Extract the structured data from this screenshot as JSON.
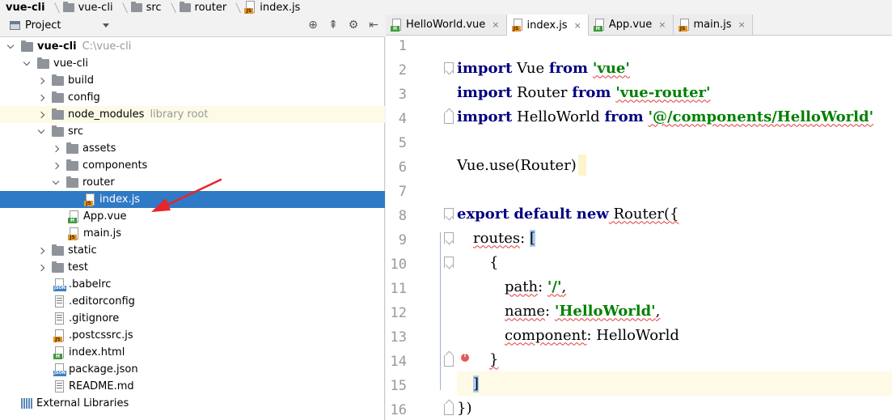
{
  "breadcrumb": [
    "vue-cli",
    "vue-cli",
    "src",
    "router",
    "index.js"
  ],
  "project_panel": {
    "title": "Project",
    "tree": [
      {
        "label": "vue-cli",
        "sub": "C:\\vue-cli",
        "type": "project",
        "state": "expanded"
      },
      {
        "label": "vue-cli",
        "type": "folder",
        "state": "expanded"
      },
      {
        "label": "build",
        "type": "folder",
        "state": "collapsed"
      },
      {
        "label": "config",
        "type": "folder",
        "state": "collapsed"
      },
      {
        "label": "node_modules",
        "sub": "library root",
        "type": "folder",
        "state": "collapsed"
      },
      {
        "label": "src",
        "type": "folder",
        "state": "expanded"
      },
      {
        "label": "assets",
        "type": "folder",
        "state": "collapsed"
      },
      {
        "label": "components",
        "type": "folder",
        "state": "collapsed"
      },
      {
        "label": "router",
        "type": "folder",
        "state": "expanded"
      },
      {
        "label": "index.js",
        "type": "js"
      },
      {
        "label": "App.vue",
        "type": "vue"
      },
      {
        "label": "main.js",
        "type": "js"
      },
      {
        "label": "static",
        "type": "folder",
        "state": "collapsed"
      },
      {
        "label": "test",
        "type": "folder",
        "state": "collapsed"
      },
      {
        "label": ".babelrc",
        "type": "json"
      },
      {
        "label": ".editorconfig",
        "type": "text"
      },
      {
        "label": ".gitignore",
        "type": "text"
      },
      {
        "label": ".postcssrc.js",
        "type": "js"
      },
      {
        "label": "index.html",
        "type": "html"
      },
      {
        "label": "package.json",
        "type": "json"
      },
      {
        "label": "README.md",
        "type": "text"
      },
      {
        "label": "External Libraries",
        "type": "libraries"
      }
    ],
    "selected": "index.js"
  },
  "tabs": [
    {
      "label": "HelloWorld.vue",
      "type": "vue",
      "active": false
    },
    {
      "label": "index.js",
      "type": "js",
      "active": true
    },
    {
      "label": "App.vue",
      "type": "vue",
      "active": false
    },
    {
      "label": "main.js",
      "type": "js",
      "active": false
    }
  ],
  "tab_close_glyph": "×",
  "icon_tags": {
    "js": "JS",
    "vue": "H",
    "html": "H",
    "json": "JSON"
  },
  "code_lines": [
    "1",
    "2",
    "3",
    "4",
    "5",
    "6",
    "7",
    "8",
    "9",
    "10",
    "11",
    "12",
    "13",
    "14",
    "15",
    "16"
  ],
  "code": {
    "l1": {
      "kw": "import",
      "name": " Vue ",
      "from": "from",
      "str": "'vue'"
    },
    "l2": {
      "kw": "import",
      "name": " Router ",
      "from": "from",
      "str": "'vue-router'"
    },
    "l3": {
      "kw": "import",
      "name": " HelloWorld ",
      "from": "from",
      "str": "'@/components/HelloWorld'"
    },
    "l5": {
      "text": "Vue.use(Router)"
    },
    "l7": {
      "kw1": "export",
      "kw2": "default",
      "kw3": "new",
      "rest": " Router({"
    },
    "l8": {
      "prop": "routes",
      "colon": ": ",
      "bracket": "["
    },
    "l9": {
      "text": "{"
    },
    "l10": {
      "prop": "path",
      "colon": ": ",
      "str": "'/'",
      "tail": ","
    },
    "l11": {
      "prop": "name",
      "colon": ": ",
      "str": "'HelloWorld'",
      "tail": ","
    },
    "l12": {
      "prop": "component",
      "colon": ": ",
      "value": "HelloWorld"
    },
    "l13": {
      "text": "}"
    },
    "l14": {
      "text": "]"
    },
    "l15": {
      "text": "})"
    }
  },
  "colors": {
    "keyword": "#000080",
    "string": "#008000",
    "selection": "#2f7ac6",
    "arrow": "#e8252a"
  }
}
